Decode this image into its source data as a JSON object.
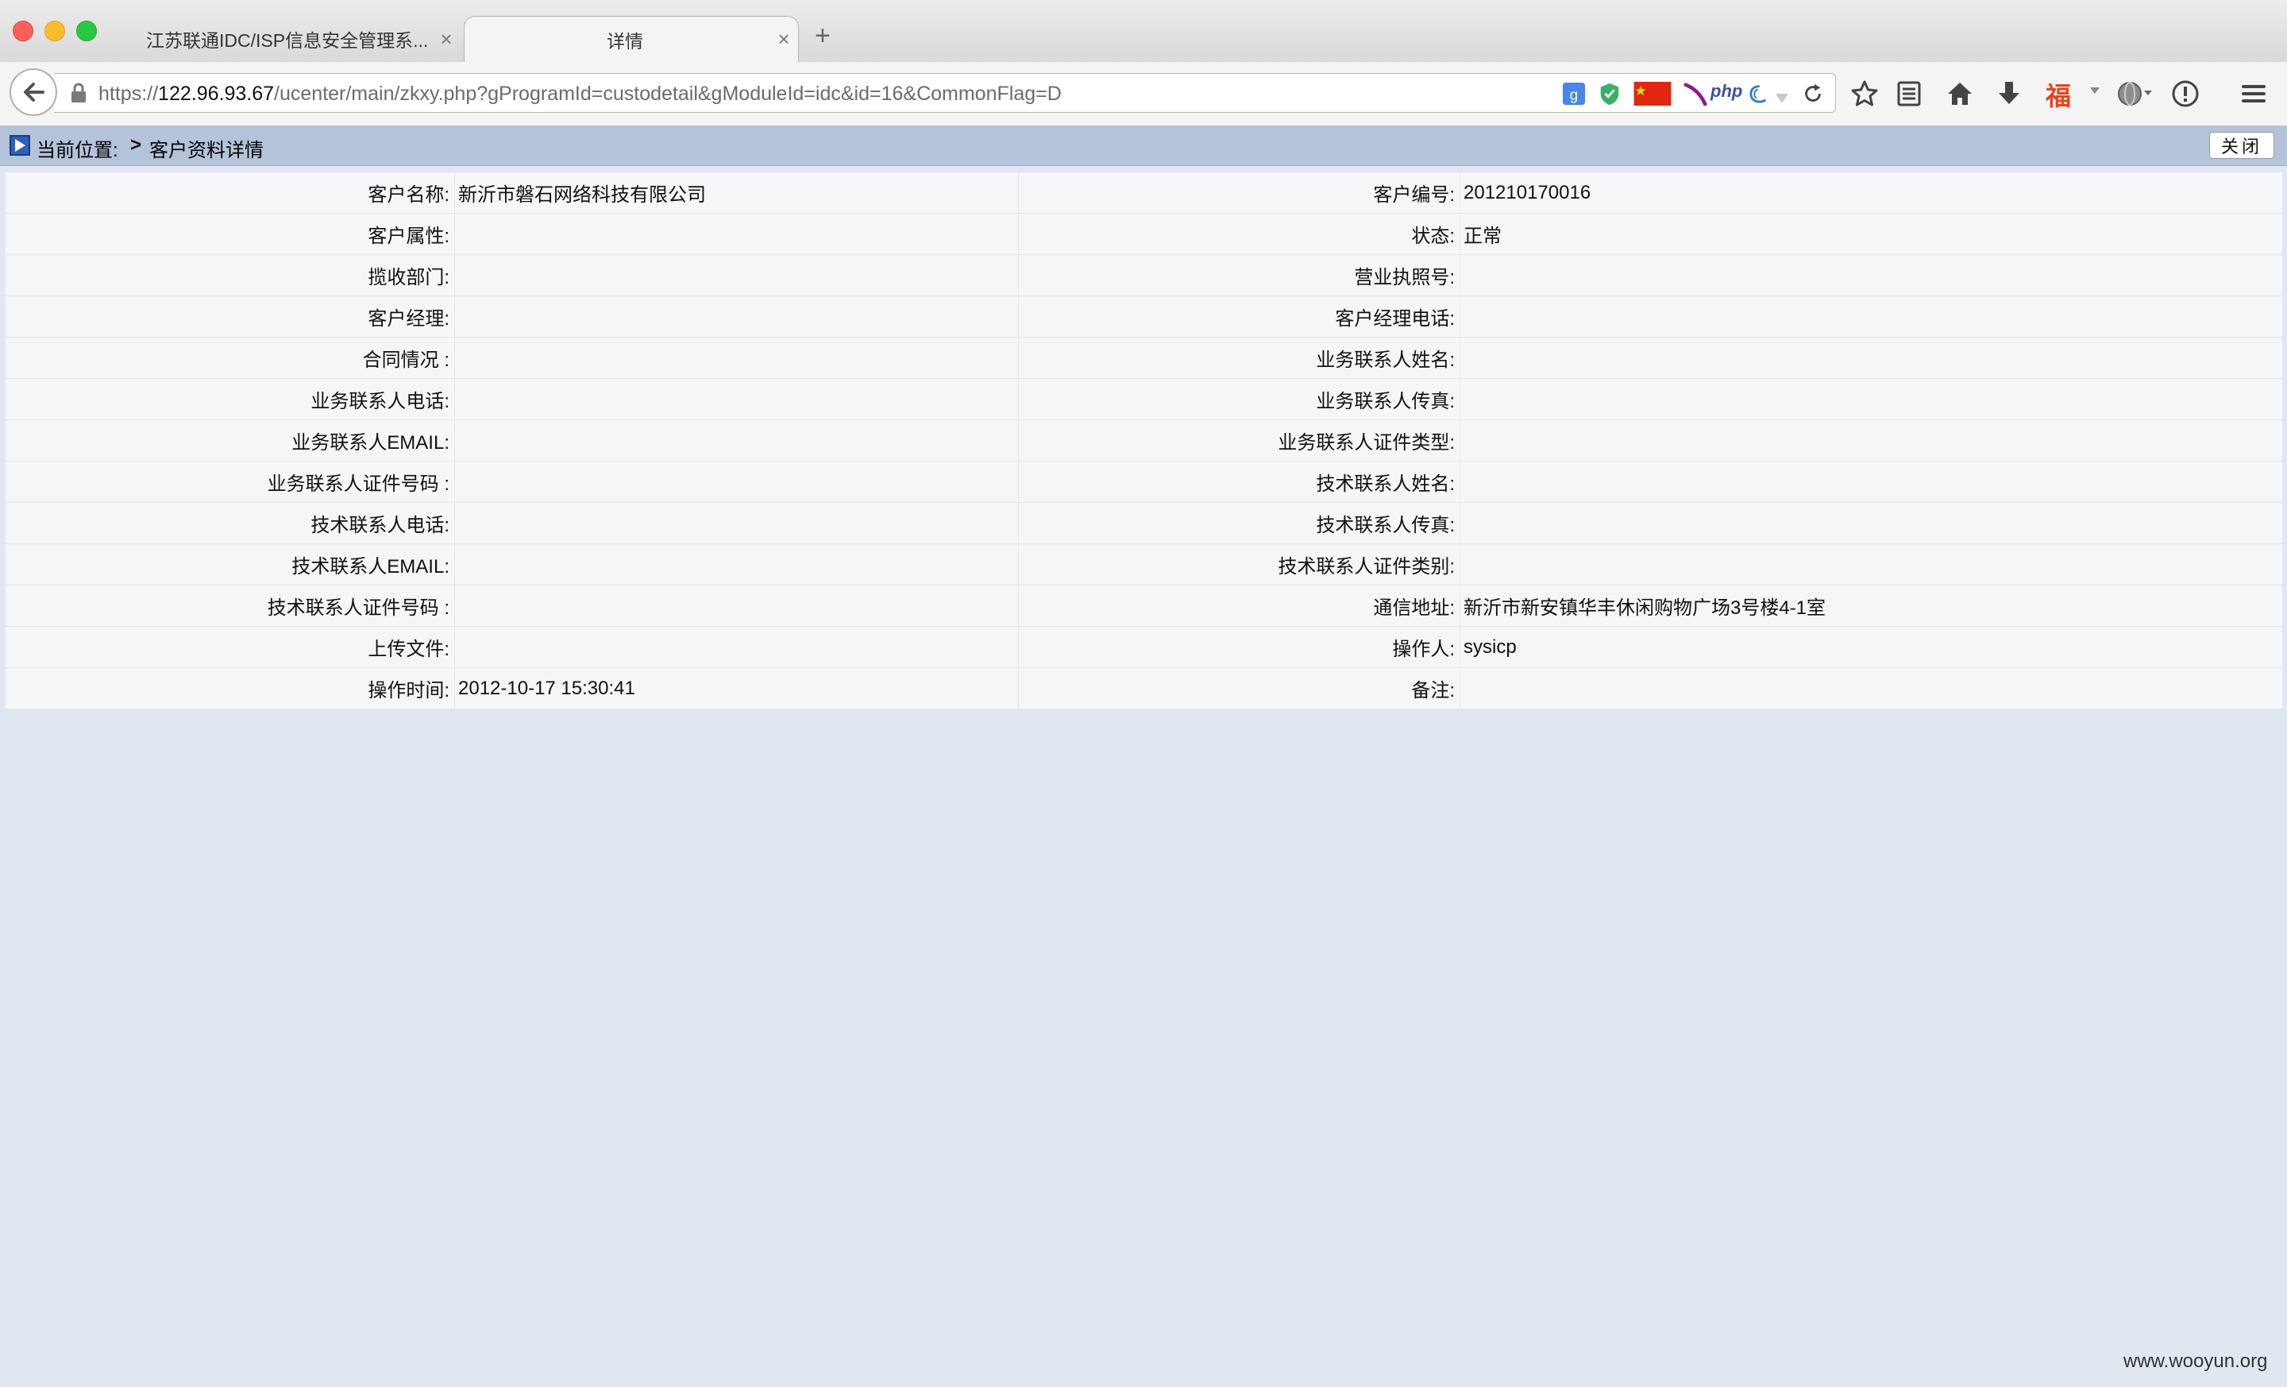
{
  "browser": {
    "tabs": [
      {
        "title": "江苏联通IDC/ISP信息安全管理系...",
        "active": false
      },
      {
        "title": "详情",
        "active": true
      }
    ],
    "url": {
      "scheme": "https://",
      "host": "122.96.93.67",
      "path": "/ucenter/main/zkxy.php?gProgramId=custodetail&gModuleId=idc&id=16&CommonFlag=D"
    },
    "extensions": {
      "php_label": "php",
      "fu_label": "福"
    }
  },
  "location": {
    "label": "当前位置:",
    "separator": ">",
    "page": "客户资料详情",
    "close_label": "关闭"
  },
  "rows": [
    {
      "l1": "客户名称:",
      "v1": "新沂市磐石网络科技有限公司",
      "l2": "客户编号:",
      "v2": "201210170016"
    },
    {
      "l1": "客户属性:",
      "v1": "",
      "l2": "状态:",
      "v2": "正常"
    },
    {
      "l1": "揽收部门:",
      "v1": "",
      "l2": "营业执照号:",
      "v2": ""
    },
    {
      "l1": "客户经理:",
      "v1": "",
      "l2": "客户经理电话:",
      "v2": ""
    },
    {
      "l1": "合同情况 :",
      "v1": "",
      "l2": "业务联系人姓名:",
      "v2": ""
    },
    {
      "l1": "业务联系人电话:",
      "v1": "",
      "l2": "业务联系人传真:",
      "v2": ""
    },
    {
      "l1": "业务联系人EMAIL:",
      "v1": "",
      "l2": "业务联系人证件类型:",
      "v2": ""
    },
    {
      "l1": "业务联系人证件号码 :",
      "v1": "",
      "l2": "技术联系人姓名:",
      "v2": ""
    },
    {
      "l1": "技术联系人电话:",
      "v1": "",
      "l2": "技术联系人传真:",
      "v2": ""
    },
    {
      "l1": "技术联系人EMAIL:",
      "v1": "",
      "l2": "技术联系人证件类别:",
      "v2": ""
    },
    {
      "l1": "技术联系人证件号码 :",
      "v1": "",
      "l2": "通信地址:",
      "v2": "新沂市新安镇华丰休闲购物广场3号楼4-1室"
    },
    {
      "l1": "上传文件:",
      "v1": "",
      "l2": "操作人:",
      "v2": "sysicp"
    },
    {
      "l1": "操作时间:",
      "v1": "2012-10-17 15:30:41",
      "l2": "备注:",
      "v2": ""
    }
  ],
  "watermark": "www.wooyun.org",
  "colors": {
    "page_bg": "#e1e7f1",
    "location_bar": "#b4c3d9",
    "table_bg": "#f5f6f8"
  }
}
